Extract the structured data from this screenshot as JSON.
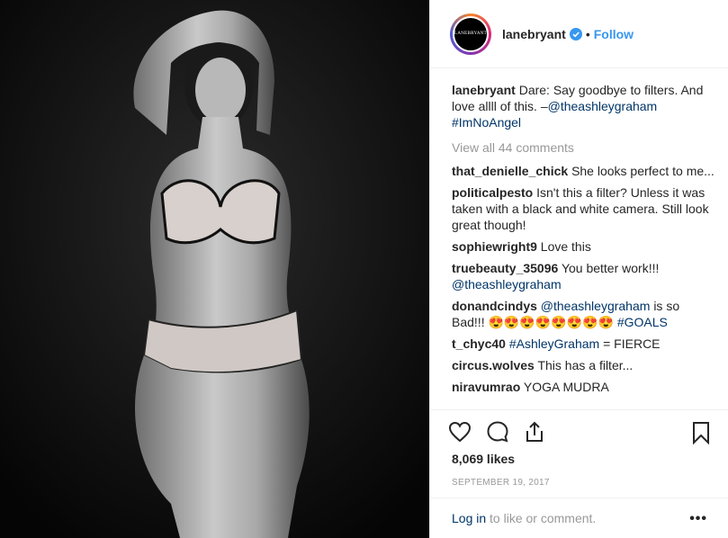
{
  "header": {
    "avatar_text": "LANEBRYANT",
    "username": "lanebryant",
    "dot": "•",
    "follow_label": "Follow"
  },
  "caption": {
    "user": "lanebryant",
    "text": "Dare: Say goodbye to filters. And love allll of this. –",
    "mention": "@theashleygraham",
    "hashtag": "#ImNoAngel"
  },
  "view_all": "View all 44 comments",
  "comments": [
    {
      "user": "that_denielle_chick",
      "text": "She looks perfect to me..."
    },
    {
      "user": "politicalpesto",
      "text": "Isn't this a filter? Unless it was taken with a black and white camera. Still look great though!"
    },
    {
      "user": "sophiewright9",
      "text": "Love this"
    },
    {
      "user": "truebeauty_35096",
      "text": "You better work!!!",
      "mention": "@theashleygraham"
    },
    {
      "user": "donandcindys",
      "mention": "@theashleygraham",
      "text": "is so Bad!!!",
      "emoji": "😍😍😍😍😍😍😍😍",
      "hashtag": "#GOALS"
    },
    {
      "user": "t_chyc40",
      "hashtag": "#AshleyGraham",
      "text": "= FIERCE"
    },
    {
      "user": "circus.wolves",
      "text": "This has a filter..."
    },
    {
      "user": "niravumrao",
      "text": "YOGA MUDRA"
    }
  ],
  "likes": "8,069 likes",
  "date": "SEPTEMBER 19, 2017",
  "login": {
    "link": "Log in",
    "rest": "to like or comment.",
    "more": "•••"
  }
}
